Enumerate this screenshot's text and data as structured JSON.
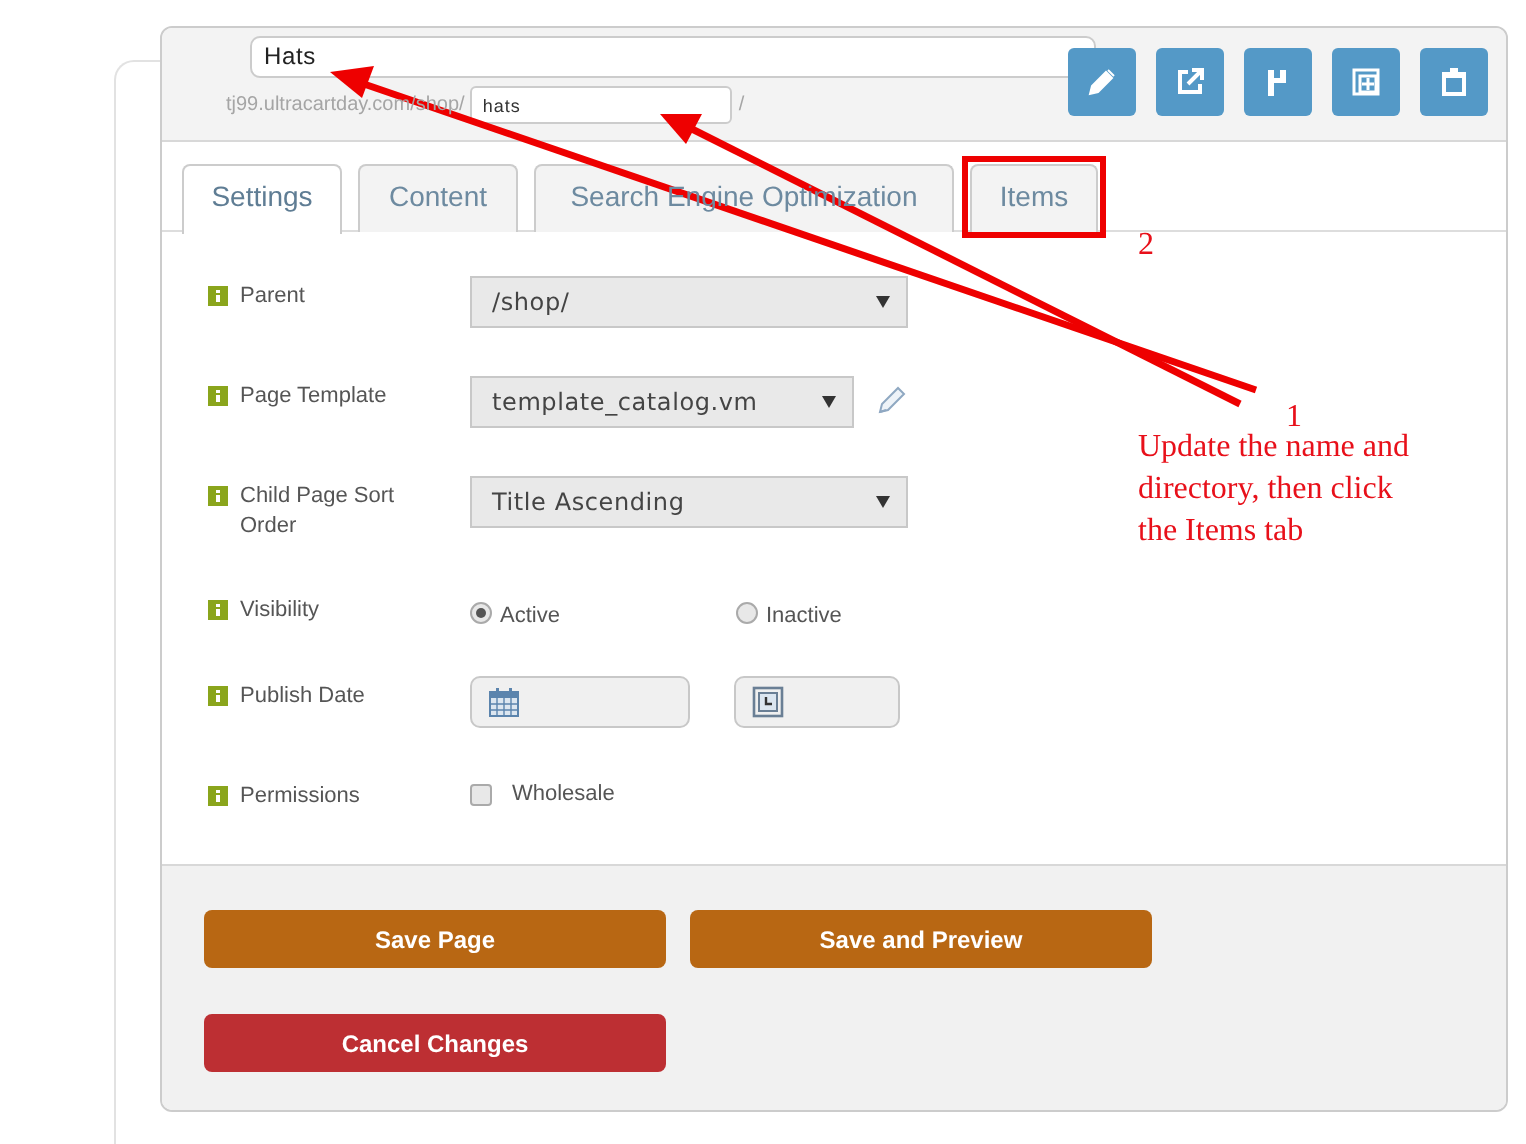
{
  "page_name": {
    "value": "Hats"
  },
  "url": {
    "prefix": "tj99.ultracartday.com/shop/",
    "slug": "hats",
    "suffix": "/"
  },
  "tabs": [
    {
      "label": "Settings",
      "selected": true
    },
    {
      "label": "Content",
      "selected": false
    },
    {
      "label": "Search Engine Optimization",
      "selected": false
    },
    {
      "label": "Items",
      "selected": false
    }
  ],
  "fields": [
    {
      "kind": "select",
      "label": "Parent",
      "value": "/shop/"
    },
    {
      "kind": "select-edit",
      "label": "Page Template",
      "value": "template_catalog.vm"
    },
    {
      "kind": "select",
      "label": "Child Page Sort Order",
      "value": "Title Ascending"
    },
    {
      "kind": "radio",
      "label": "Visibility",
      "options": [
        {
          "label": "Active",
          "selected": true
        },
        {
          "label": "Inactive",
          "selected": false
        }
      ]
    },
    {
      "kind": "datetime",
      "label": "Publish Date"
    },
    {
      "kind": "checkbox",
      "label": "Permissions",
      "options": [
        {
          "label": "Wholesale",
          "checked": false
        }
      ]
    }
  ],
  "actions": [
    {
      "kind": "primary",
      "label": "Save Page"
    },
    {
      "kind": "primary",
      "label": "Save and Preview"
    },
    {
      "kind": "danger",
      "label": "Cancel Changes"
    }
  ],
  "annotations": {
    "steps": [
      {
        "number": "2"
      },
      {
        "number": "1",
        "text": "Update the name and directory, then click the Items tab"
      }
    ]
  }
}
